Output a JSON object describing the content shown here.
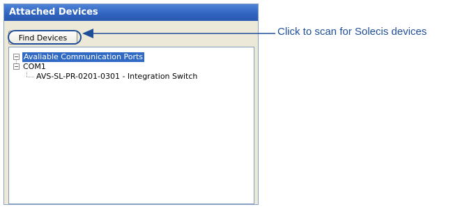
{
  "panel": {
    "title": "Attached Devices",
    "find_button_label": "Find Devices"
  },
  "tree": {
    "root": {
      "label": "Avaliable Communication Ports",
      "expanded": true,
      "selected": true,
      "children": [
        {
          "label": "COM1",
          "expanded": true,
          "children": [
            {
              "label": "AVS-SL-PR-0201-0301 - Integration Switch"
            }
          ]
        }
      ]
    }
  },
  "callout": {
    "text": "Click to scan for Solecis devices",
    "color": "#1f4e99"
  },
  "icons": {
    "expand": "minus-box-icon",
    "arrow": "arrow-left-icon"
  },
  "colors": {
    "titlebar": "#2f63bf",
    "selection": "#316ac5",
    "panel_bg": "#ece9d8"
  }
}
